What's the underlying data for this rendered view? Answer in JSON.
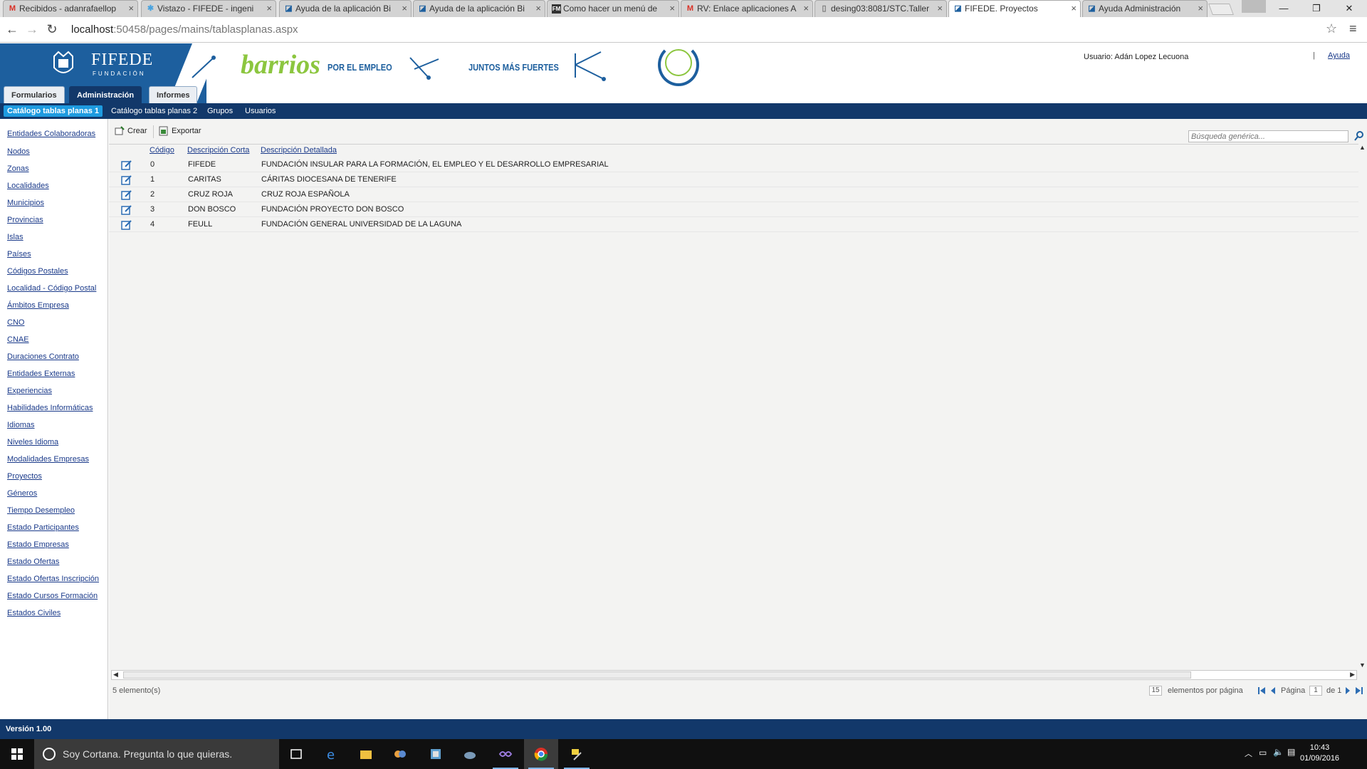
{
  "browser": {
    "tabs": [
      {
        "title": "Recibidos - adanrafaellop",
        "icon": "gmail-icon"
      },
      {
        "title": "Vistazo - FIFEDE - ingeni",
        "icon": "jira-icon"
      },
      {
        "title": "Ayuda de la aplicación Bi",
        "icon": "help-doc-icon"
      },
      {
        "title": "Ayuda de la aplicación Bi",
        "icon": "help-doc-icon"
      },
      {
        "title": "Como hacer un menú de",
        "icon": "fm-icon"
      },
      {
        "title": "RV: Enlace aplicaciones A",
        "icon": "gmail-icon"
      },
      {
        "title": "desing03:8081/STC.Taller",
        "icon": "page-icon"
      },
      {
        "title": "FIFEDE. Proyectos",
        "icon": "help-doc-icon"
      },
      {
        "title": "Ayuda Administración",
        "icon": "help-doc-icon"
      }
    ],
    "url_host": "localhost",
    "url_rest": ":50458/pages/mains/tablasplanas.aspx"
  },
  "header": {
    "org_name": "FIFEDE",
    "org_sub": "FUNDACIÓN",
    "barrios": "barrios",
    "por_empleo": "POR EL EMPLEO",
    "juntos": "JUNTOS MÁS FUERTES",
    "user": "Usuario: Adán Lopez Lecuona",
    "separator": "|",
    "help_link": "Ayuda"
  },
  "main_tabs": [
    "Formularios",
    "Administración",
    "Informes"
  ],
  "sub_nav": [
    "Catálogo tablas planas 1",
    "Catálogo tablas planas 2",
    "Grupos",
    "Usuarios"
  ],
  "sidebar": [
    "Entidades Colaboradoras",
    "Nodos",
    "Zonas",
    "Localidades",
    "Municipios",
    "Provincias",
    "Islas",
    "Países",
    "Códigos Postales",
    "Localidad - Código Postal",
    "Ámbitos Empresa",
    "CNO",
    "CNAE",
    "Duraciones Contrato",
    "Entidades Externas",
    "Experiencias",
    "Habilidades Informáticas",
    "Idiomas",
    "Niveles Idioma",
    "Modalidades Empresas",
    "Proyectos",
    "Géneros",
    "Tiempo Desempleo",
    "Estado Participantes",
    "Estado Empresas",
    "Estado Ofertas",
    "Estado Ofertas Inscripción",
    "Estado Cursos Formación",
    "Estados Civiles"
  ],
  "toolbar": {
    "create": "Crear",
    "export": "Exportar",
    "search_placeholder": "Búsqueda genérica..."
  },
  "grid": {
    "columns": [
      "Código",
      "Descripción Corta",
      "Descripción Detallada"
    ],
    "rows": [
      [
        "0",
        "FIFEDE",
        "FUNDACIÓN INSULAR PARA LA FORMACIÓN, EL EMPLEO Y EL DESARROLLO EMPRESARIAL"
      ],
      [
        "1",
        "CARITAS",
        "CÁRITAS DIOCESANA DE TENERIFE"
      ],
      [
        "2",
        "CRUZ ROJA",
        "CRUZ ROJA ESPAÑOLA"
      ],
      [
        "3",
        "DON BOSCO",
        "FUNDACIÓN PROYECTO DON BOSCO"
      ],
      [
        "4",
        "FEULL",
        "FUNDACIÓN GENERAL UNIVERSIDAD DE LA LAGUNA"
      ]
    ]
  },
  "pager": {
    "count_text": "5 elemento(s)",
    "page_size": "15",
    "page_size_label": "elementos por página",
    "page_label": "Página",
    "current_page": "1",
    "of_label": "de 1"
  },
  "footer": {
    "version": "Versión 1.00"
  },
  "taskbar": {
    "cortana": "Soy Cortana. Pregunta lo que quieras.",
    "time": "10:43",
    "date": "01/09/2016"
  },
  "colors": {
    "brand_blue": "#1d5f9e",
    "nav_dark": "#12386a",
    "active_sub": "#1e9be0",
    "barrios_green": "#8cc63f"
  }
}
